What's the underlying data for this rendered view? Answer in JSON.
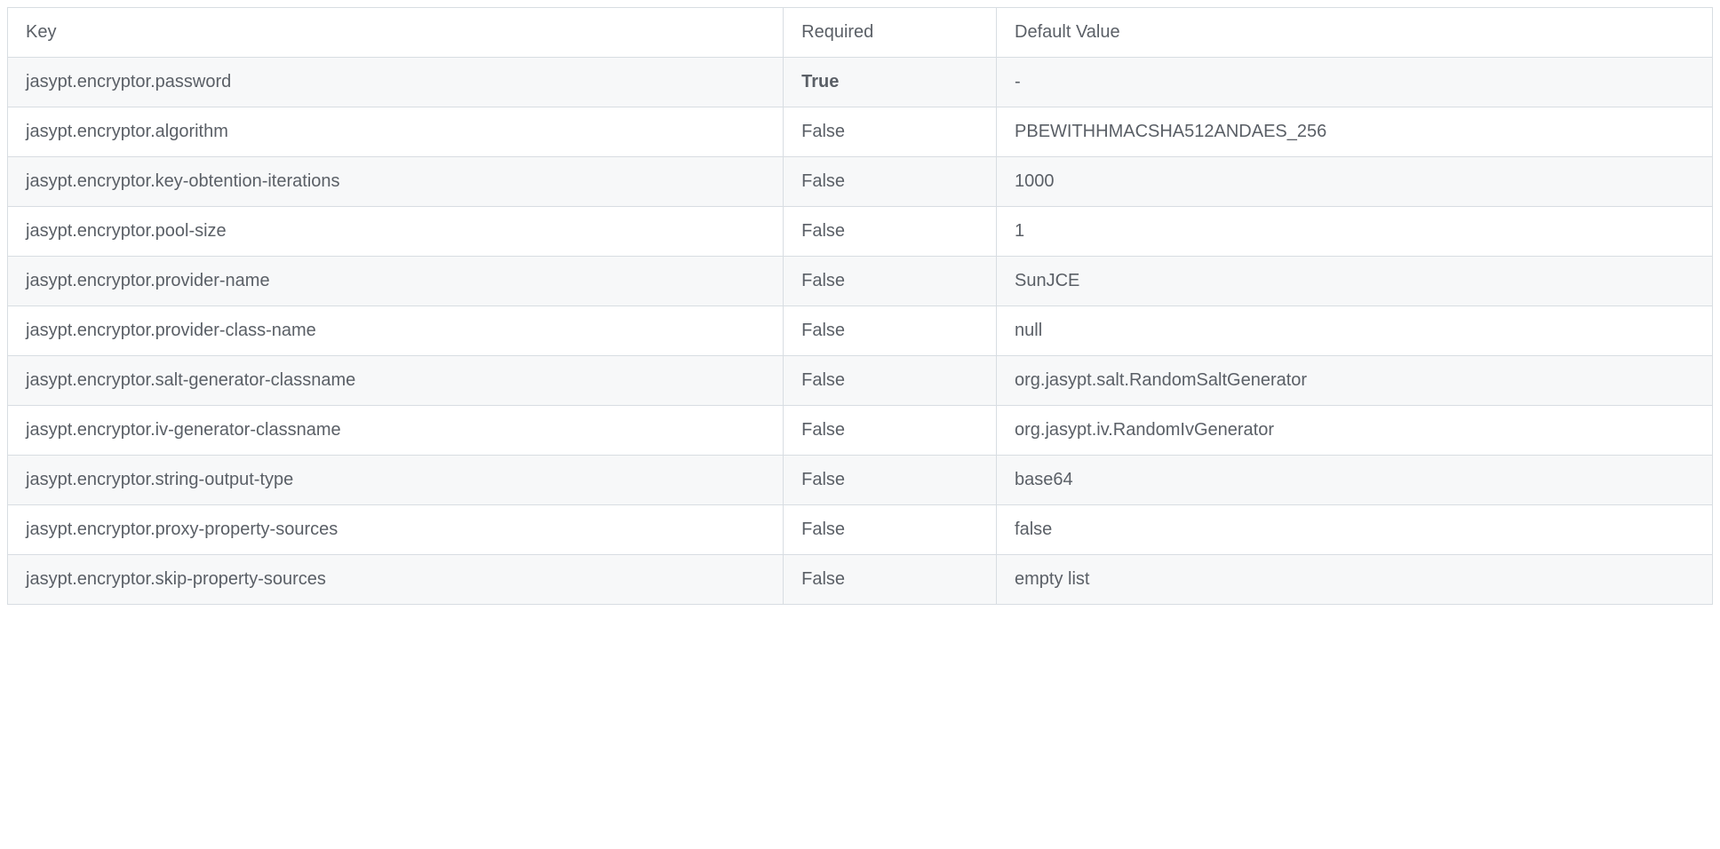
{
  "headers": {
    "key": "Key",
    "required": "Required",
    "default": "Default Value"
  },
  "rows": [
    {
      "key": "jasypt.encryptor.password",
      "required": "True",
      "required_bold": true,
      "default": "-"
    },
    {
      "key": "jasypt.encryptor.algorithm",
      "required": "False",
      "required_bold": false,
      "default": "PBEWITHHMACSHA512ANDAES_256"
    },
    {
      "key": "jasypt.encryptor.key-obtention-iterations",
      "required": "False",
      "required_bold": false,
      "default": "1000"
    },
    {
      "key": "jasypt.encryptor.pool-size",
      "required": "False",
      "required_bold": false,
      "default": "1"
    },
    {
      "key": "jasypt.encryptor.provider-name",
      "required": "False",
      "required_bold": false,
      "default": "SunJCE"
    },
    {
      "key": "jasypt.encryptor.provider-class-name",
      "required": "False",
      "required_bold": false,
      "default": "null"
    },
    {
      "key": "jasypt.encryptor.salt-generator-classname",
      "required": "False",
      "required_bold": false,
      "default": "org.jasypt.salt.RandomSaltGenerator"
    },
    {
      "key": "jasypt.encryptor.iv-generator-classname",
      "required": "False",
      "required_bold": false,
      "default": "org.jasypt.iv.RandomIvGenerator"
    },
    {
      "key": "jasypt.encryptor.string-output-type",
      "required": "False",
      "required_bold": false,
      "default": "base64"
    },
    {
      "key": "jasypt.encryptor.proxy-property-sources",
      "required": "False",
      "required_bold": false,
      "default": "false"
    },
    {
      "key": "jasypt.encryptor.skip-property-sources",
      "required": "False",
      "required_bold": false,
      "default": "empty list"
    }
  ]
}
